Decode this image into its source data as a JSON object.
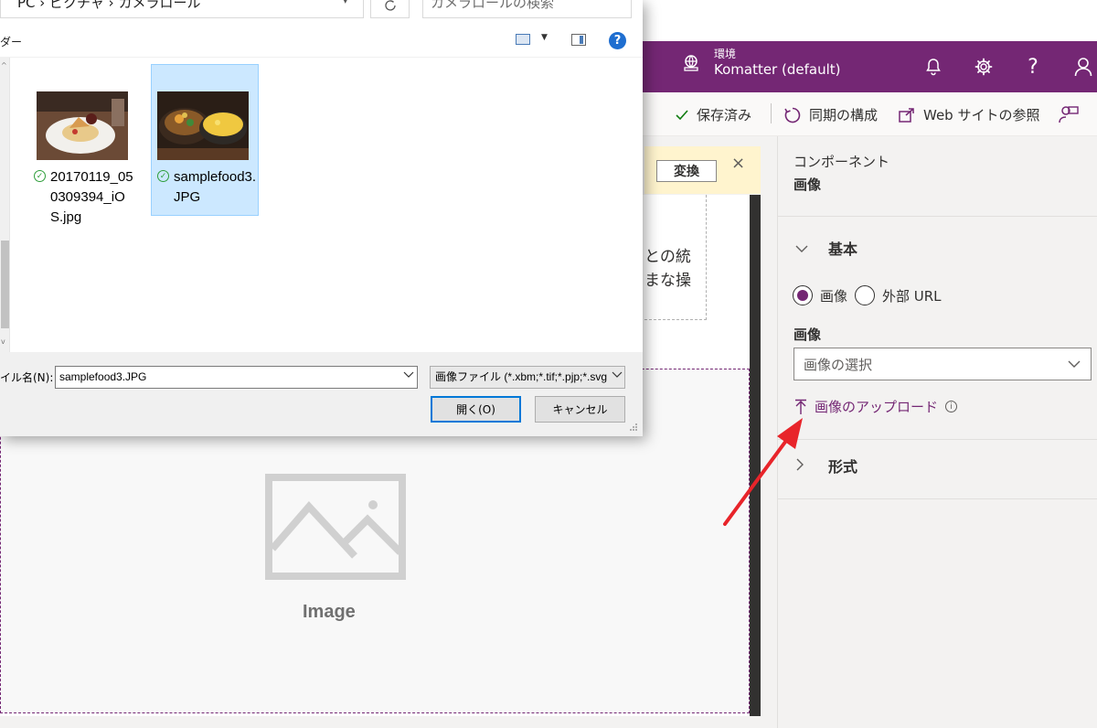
{
  "app": {
    "env_label": "環境",
    "env_name": "Komatter (default)",
    "commands": {
      "saved": "保存済み",
      "sync": "同期の構成",
      "browse": "Web サイトの参照"
    },
    "banner": {
      "convert_label": "変換",
      "close": "×"
    },
    "canvas": {
      "text_line1": "との統",
      "text_line2": "まな操",
      "image_label": "Image"
    },
    "props": {
      "kind": "コンポーネント",
      "title": "画像",
      "section_basic": "基本",
      "radio_image": "画像",
      "radio_external": "外部 URL",
      "field_image_label": "画像",
      "dropdown_placeholder": "画像の選択",
      "upload_link": "画像のアップロード",
      "section_format": "形式"
    }
  },
  "dialog": {
    "address": "PC › ピクチャ › カメラロール",
    "search_placeholder": "カメラロールの検索",
    "toolbar_folder": "ダー",
    "files": [
      {
        "name": "20170119_050309394_iOS.jpg",
        "selected": false
      },
      {
        "name": "samplefood3.JPG",
        "selected": true
      }
    ],
    "filename_label": "イル名(N):",
    "filename_value": "samplefood3.JPG",
    "filetype_value": "画像ファイル (*.xbm;*.tif;*.pjp;*.svg",
    "open_button": "開く(O)",
    "cancel_button": "キャンセル"
  },
  "colors": {
    "brand": "#742774",
    "annotation_arrow": "#e8242a",
    "dialog_primary_border": "#0078d7"
  }
}
